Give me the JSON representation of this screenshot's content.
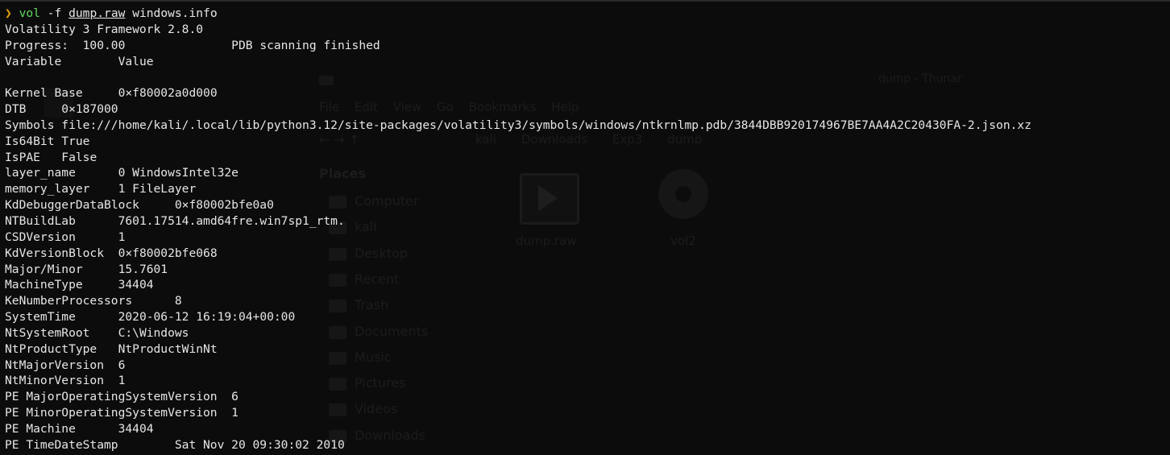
{
  "prompt": {
    "symbol": "❯",
    "command": "vol",
    "flag": " -f ",
    "file": "dump.raw",
    "plugin": " windows.info"
  },
  "output_lines": [
    "Volatility 3 Framework 2.8.0",
    "Progress:  100.00\t\tPDB scanning finished",
    "Variable\tValue",
    "",
    "Kernel Base\t0×f80002a0d000",
    "DTB\t0×187000",
    "Symbols\tfile:///home/kali/.local/lib/python3.12/site-packages/volatility3/symbols/windows/ntkrnlmp.pdb/3844DBB920174967BE7AA4A2C20430FA-2.json.xz",
    "Is64Bit\tTrue",
    "IsPAE\tFalse",
    "layer_name\t0 WindowsIntel32e",
    "memory_layer\t1 FileLayer",
    "KdDebuggerDataBlock\t0×f80002bfe0a0",
    "NTBuildLab\t7601.17514.amd64fre.win7sp1_rtm.",
    "CSDVersion\t1",
    "KdVersionBlock\t0×f80002bfe068",
    "Major/Minor\t15.7601",
    "MachineType\t34404",
    "KeNumberProcessors\t8",
    "SystemTime\t2020-06-12 16:19:04+00:00",
    "NtSystemRoot\tC:\\Windows",
    "NtProductType\tNtProductWinNt",
    "NtMajorVersion\t6",
    "NtMinorVersion\t1",
    "PE MajorOperatingSystemVersion\t6",
    "PE MinorOperatingSystemVersion\t1",
    "PE Machine\t34404",
    "PE TimeDateStamp\tSat Nov 20 09:30:02 2010"
  ],
  "background_window": {
    "title": "dump - Thunar",
    "menu": "File Edit View Go Bookmarks Help",
    "path": "kali Downloads Exp3 dump",
    "places_heading": "Places",
    "places": [
      "Computer",
      "kali",
      "Desktop",
      "Recent",
      "Trash",
      "Documents",
      "Music",
      "Pictures",
      "Videos",
      "Downloads"
    ],
    "files": [
      "dump.raw",
      "vol2"
    ]
  },
  "colors": {
    "background": "#0c0c0c",
    "text": "#e6e6e6",
    "prompt_symbol": "#e5a50a",
    "command": "#5fd75f"
  }
}
